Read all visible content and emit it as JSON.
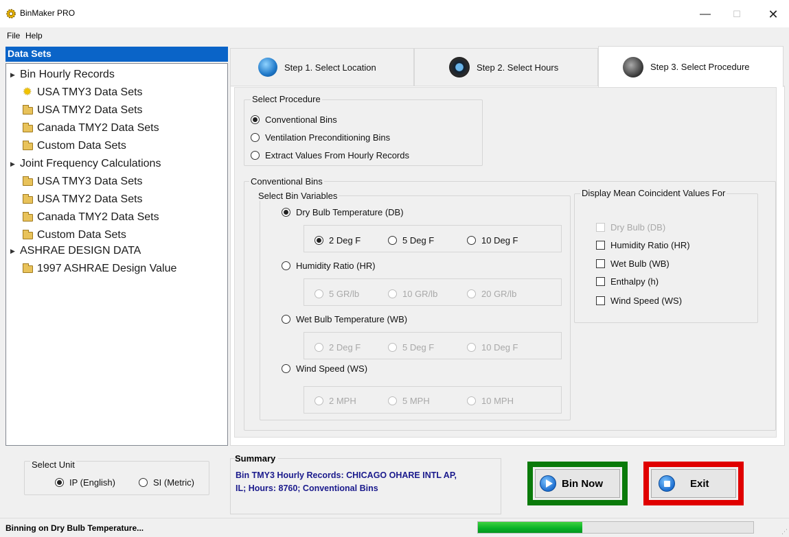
{
  "window": {
    "title": "BinMaker PRO",
    "min": "—",
    "max": "☐",
    "close": "✕"
  },
  "menu": {
    "file": "File",
    "help": "Help"
  },
  "datasets": {
    "header": "Data Sets",
    "tree": [
      {
        "label": "Bin Hourly Records",
        "kind": "root"
      },
      {
        "label": "USA TMY3 Data Sets",
        "kind": "selected"
      },
      {
        "label": "USA TMY2 Data Sets",
        "kind": "folder"
      },
      {
        "label": "Canada TMY2 Data Sets",
        "kind": "folder"
      },
      {
        "label": "Custom Data Sets",
        "kind": "folder"
      },
      {
        "label": "Joint Frequency Calculations",
        "kind": "root"
      },
      {
        "label": "USA TMY3 Data Sets",
        "kind": "folder"
      },
      {
        "label": "USA TMY2 Data Sets",
        "kind": "folder"
      },
      {
        "label": "Canada TMY2 Data Sets",
        "kind": "folder"
      },
      {
        "label": "Custom Data Sets",
        "kind": "folder"
      },
      {
        "label": "ASHRAE DESIGN DATA",
        "kind": "root"
      },
      {
        "label": "1997 ASHRAE Design Value",
        "kind": "folder"
      }
    ]
  },
  "tabs": {
    "step1": "Step 1.  Select Location",
    "step2": "Step 2.  Select Hours",
    "step3": "Step 3.  Select Procedure",
    "active": "step3"
  },
  "procedure": {
    "title": "Select Procedure",
    "options": [
      "Conventional Bins",
      "Ventilation Preconditioning Bins",
      "Extract Values From Hourly Records"
    ],
    "selected": "Conventional Bins"
  },
  "conventional": {
    "title": "Conventional Bins",
    "variables_title": "Select Bin Variables",
    "db": {
      "label": "Dry Bulb Temperature (DB)",
      "checked": true,
      "opts": [
        "2 Deg F",
        "5 Deg F",
        "10 Deg F"
      ],
      "selected": "2 Deg F"
    },
    "hr": {
      "label": "Humidity Ratio (HR)",
      "opts": [
        "5 GR/lb",
        "10 GR/lb",
        "20 GR/lb"
      ]
    },
    "wb": {
      "label": "Wet Bulb Temperature (WB)",
      "opts": [
        "2 Deg F",
        "5 Deg F",
        "10 Deg F"
      ]
    },
    "ws": {
      "label": "Wind Speed (WS)",
      "opts": [
        "2 MPH",
        "5 MPH",
        "10 MPH"
      ]
    }
  },
  "coincident": {
    "title": "Display Mean Coincident Values For",
    "items": [
      "Dry Bulb (DB)",
      "Humidity Ratio (HR)",
      "Wet Bulb (WB)",
      "Enthalpy (h)",
      "Wind Speed (WS)"
    ]
  },
  "unit": {
    "title": "Select Unit",
    "ip": "IP (English)",
    "si": "SI (Metric)",
    "selected": "IP (English)"
  },
  "summary": {
    "title": "Summary",
    "line1": "Bin TMY3 Hourly Records: CHICAGO OHARE INTL AP,",
    "line2": "IL; Hours: 8760; Conventional Bins"
  },
  "buttons": {
    "bin_now": "Bin Now",
    "exit": "Exit"
  },
  "colors": {
    "bin_now_frame": "#0a7a0a",
    "exit_frame": "#e00000",
    "header_blue": "#0a64c8",
    "summary_text": "#1a1a8c"
  },
  "status": {
    "text": "Binning on Dry Bulb Temperature...",
    "progress_fraction": 0.38
  }
}
